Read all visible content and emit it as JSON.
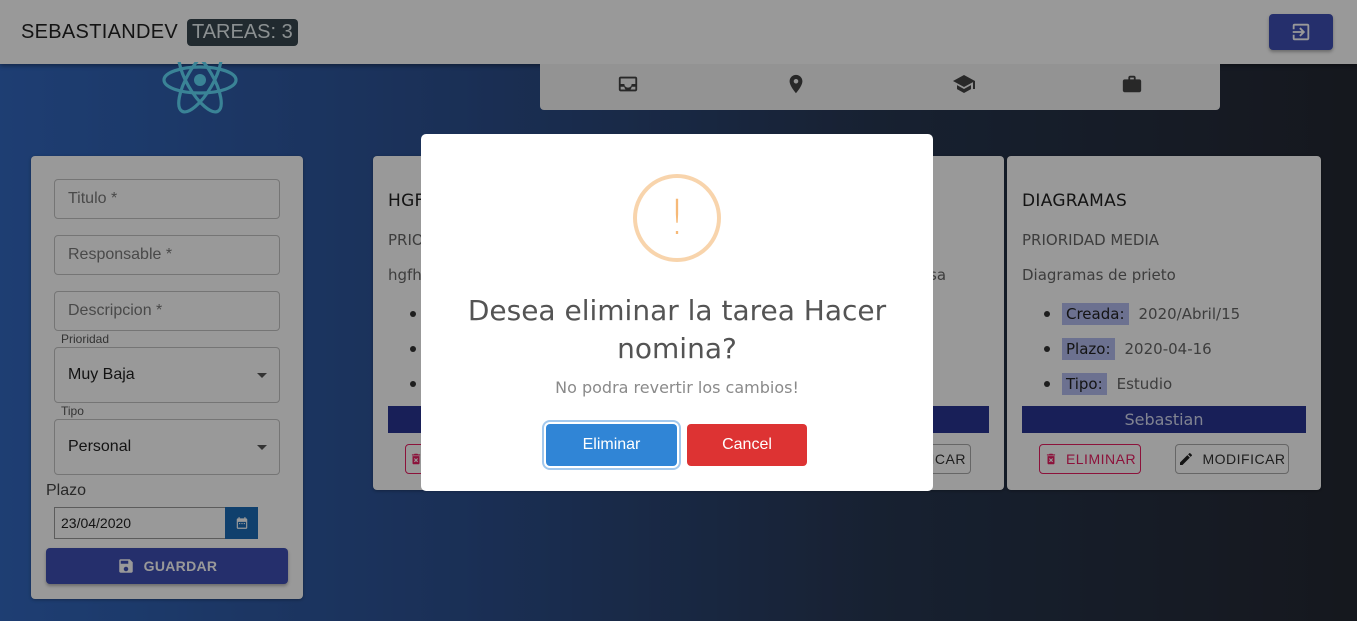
{
  "appbar": {
    "brand": "SEBASTIANDEV",
    "task_count_label": "TAREAS: 3",
    "logout_icon": "logout-icon"
  },
  "nav": {
    "icons": [
      "inbox-icon",
      "location-pin-icon",
      "school-icon",
      "briefcase-icon"
    ]
  },
  "form": {
    "title_placeholder": "Titulo *",
    "responsible_placeholder": "Responsable *",
    "description_placeholder": "Descripcion *",
    "priority_label": "Prioridad",
    "priority_value": "Muy Baja",
    "type_label": "Tipo",
    "type_value": "Personal",
    "deadline_label": "Plazo",
    "deadline_value": "23/04/2020",
    "save_label": "GUARDAR"
  },
  "tasks": [
    {
      "title": "HGF",
      "priority": "PRIO",
      "description": "hgfh",
      "description_tail": "sa",
      "modify_tail": "ICAR"
    },
    {
      "title": "DIAGRAMAS",
      "priority": "PRIORIDAD MEDIA",
      "description": "Diagramas de prieto",
      "created_label": "Creada:",
      "created_value": "2020/Abril/15",
      "deadline_label": "Plazo:",
      "deadline_value": "2020-04-16",
      "type_label": "Tipo:",
      "type_value": "Estudio",
      "owner": "Sebastian",
      "delete_label": "ELIMINAR",
      "modify_label": "MODIFICAR"
    }
  ],
  "modal": {
    "icon": "!",
    "title": "Desea eliminar la tarea Hacer nomina?",
    "text": "No podra revertir los cambios!",
    "confirm_label": "Eliminar",
    "cancel_label": "Cancel"
  },
  "colors": {
    "primary": "#3f4fb4",
    "badge": "#37474f",
    "owner_bar": "#283593",
    "chip": "#b5bdf0",
    "delete": "#e91e63",
    "confirm": "#3085d6",
    "cancel": "#dd3333",
    "warning": "#f8bb86"
  }
}
